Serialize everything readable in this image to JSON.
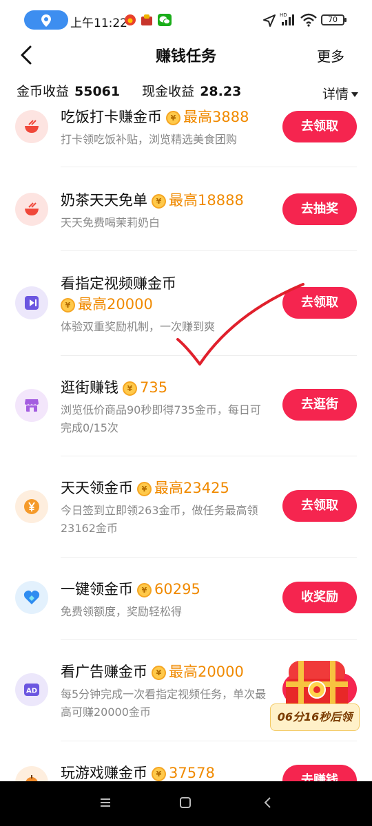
{
  "status": {
    "time": "上午11:22",
    "battery": "70",
    "hd_label": "HD"
  },
  "header": {
    "title": "赚钱任务",
    "more": "更多"
  },
  "earnings": {
    "coin_label": "金币收益",
    "coin_value": "55061",
    "cash_label": "现金收益",
    "cash_value": "28.23",
    "detail": "详情"
  },
  "coin_symbol": "¥",
  "tasks": [
    {
      "title": "吃饭打卡赚金币",
      "reward": "最高3888",
      "desc": "打卡领吃饭补贴，浏览精选美食团购",
      "button": "去领取",
      "icon": "rice-bowl-icon"
    },
    {
      "title": "奶茶天天免单",
      "reward": "最高18888",
      "desc": "天天免费喝茉莉奶白",
      "button": "去抽奖",
      "icon": "rice-bowl-icon"
    },
    {
      "title": "看指定视频赚金币",
      "reward": "最高20000",
      "desc": "体验双重奖励机制，一次赚到爽",
      "button": "去领取",
      "icon": "video-play-icon"
    },
    {
      "title": "逛街赚钱",
      "reward": "735",
      "desc": "浏览低价商品90秒即得735金币，每日可完成0/15次",
      "button": "去逛街",
      "icon": "shop-icon"
    },
    {
      "title": "天天领金币",
      "reward": "最高23425",
      "desc": "今日签到立即领263金币，做任务最高领23162金币",
      "button": "去领取",
      "icon": "yuan-coin-icon"
    },
    {
      "title": "一键领金币",
      "reward": "60295",
      "desc": "免费领额度，奖励轻松得",
      "button": "收奖励",
      "icon": "heart-shield-icon"
    },
    {
      "title": "看广告赚金币",
      "reward": "最高20000",
      "desc": "每5分钟完成一次看指定视频任务，单次最高可赚20000金币",
      "button": "",
      "icon": "ad-icon"
    },
    {
      "title": "玩游戏赚金币",
      "reward": "37578",
      "desc": "",
      "button": "去赚钱",
      "icon": "game-icon"
    }
  ],
  "chest": {
    "timer": "06分16秒后领"
  },
  "colors": {
    "accent_red": "#f5254f",
    "reward_orange": "#f08a00",
    "status_blue": "#3d8ef0"
  }
}
